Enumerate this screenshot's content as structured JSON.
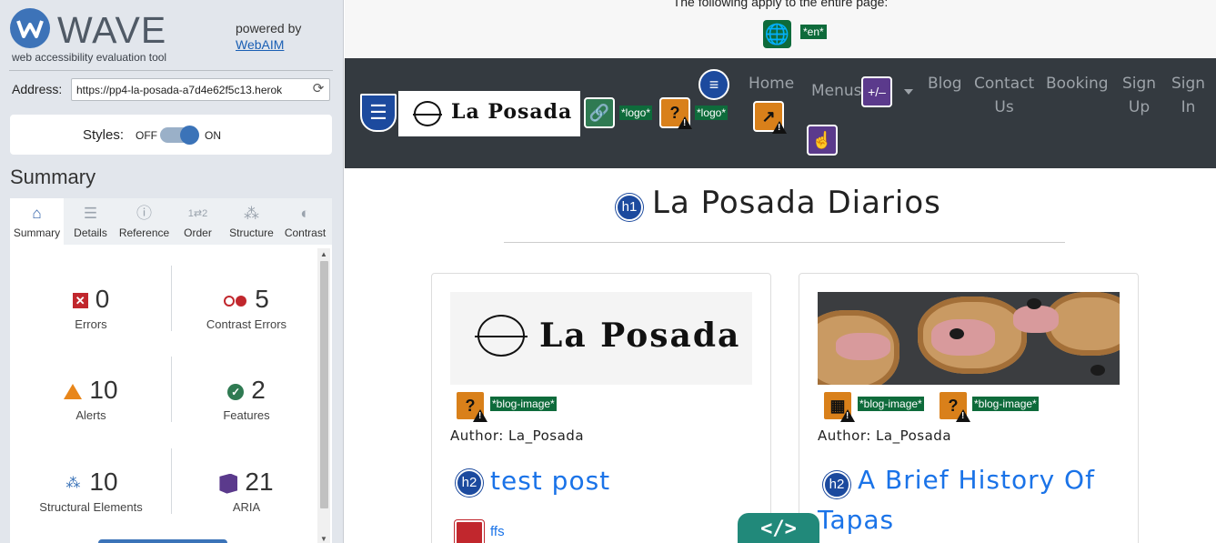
{
  "wave": {
    "word": "WAVE",
    "tagline": "web accessibility evaluation tool",
    "powered_by": "powered by",
    "webaim": "WebAIM",
    "address_label": "Address:",
    "address_value": "https://pp4-la-posada-a7d4e62f5c13.herok",
    "styles_label": "Styles:",
    "styles_off": "OFF",
    "styles_on": "ON",
    "styles_state": "on",
    "summary_heading": "Summary",
    "tabs": [
      {
        "label": "Summary",
        "icon": "home-icon",
        "active": true
      },
      {
        "label": "Details",
        "icon": "list-icon",
        "active": false
      },
      {
        "label": "Reference",
        "icon": "info-icon",
        "active": false
      },
      {
        "label": "Order",
        "icon": "order-icon",
        "active": false
      },
      {
        "label": "Structure",
        "icon": "structure-icon",
        "active": false
      },
      {
        "label": "Contrast",
        "icon": "contrast-icon",
        "active": false
      }
    ],
    "stats": {
      "errors": {
        "count": "0",
        "label": "Errors"
      },
      "contrast_errors": {
        "count": "5",
        "label": "Contrast Errors"
      },
      "alerts": {
        "count": "10",
        "label": "Alerts"
      },
      "features": {
        "count": "2",
        "label": "Features"
      },
      "structural": {
        "count": "10",
        "label": "Structural Elements"
      },
      "aria": {
        "count": "21",
        "label": "ARIA"
      }
    },
    "colors": {
      "brand": "#3d73b8",
      "error": "#c1272d",
      "alert": "#e8861a",
      "feature": "#2f7a52",
      "aria": "#5b3a8c"
    }
  },
  "page": {
    "notice": "The following apply to the entire page:",
    "lang_tag": "*en*",
    "logo_text": "La Posada",
    "logo_tag_1": "*logo*",
    "logo_tag_2": "*logo*",
    "nav": {
      "home": "Home",
      "menus": "Menus",
      "blog": "Blog",
      "contact_1": "Contact",
      "contact_2": "Us",
      "booking": "Booking",
      "signup_1": "Sign",
      "signup_2": "Up",
      "signin_1": "Sign",
      "signin_2": "In",
      "plusminus": "+/–"
    },
    "title": "La Posada Diarios",
    "h1_badge": "h1",
    "h2_badge": "h2",
    "cards": [
      {
        "image_logo": "La Posada",
        "tag": "*blog-image*",
        "author": "Author: La_Posada",
        "title": "test post",
        "excerpt": "ffs"
      },
      {
        "tag_1": "*blog-image*",
        "tag_2": "*blog-image*",
        "author": "Author: La_Posada",
        "title_line1": "A Brief History Of",
        "title_line2": "Tapas"
      }
    ],
    "code_tab": "</>"
  }
}
